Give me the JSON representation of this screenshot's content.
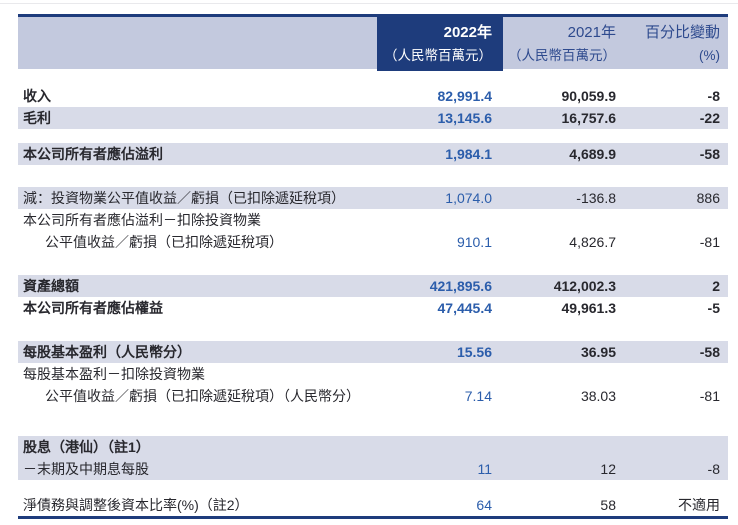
{
  "colors": {
    "navy": "#1e3c7c",
    "header_band": "#c3c9de",
    "row_stripe": "#d8dbe8",
    "value_2022_blue": "#2b5dab",
    "text_dark": "#28282e",
    "header_text_navy": "#2e4a8e"
  },
  "table": {
    "header": {
      "col2022": {
        "year": "2022年",
        "unit": "（人民幣百萬元）"
      },
      "col2021": {
        "year": "2021年",
        "unit": "（人民幣百萬元）"
      },
      "colpct": {
        "title": "百分比變動",
        "unit": "(%)"
      }
    },
    "rows": [
      {
        "label": "收入",
        "bold": true,
        "stripe": false,
        "v2022": "82,991.4",
        "v2021": "90,059.9",
        "pct": "-8"
      },
      {
        "label": "毛利",
        "bold": true,
        "stripe": true,
        "v2022": "13,145.6",
        "v2021": "16,757.6",
        "pct": "-22"
      },
      {
        "type": "spacer",
        "size": "s"
      },
      {
        "label": "本公司所有者應佔溢利",
        "bold": true,
        "stripe": true,
        "v2022": "1,984.1",
        "v2021": "4,689.9",
        "pct": "-58"
      },
      {
        "type": "spacer",
        "size": "m"
      },
      {
        "label": "減：投資物業公平值收益／虧損（已扣除遞延稅項）",
        "bold": false,
        "stripe": true,
        "v2022": "1,074.0",
        "v2021": "-136.8",
        "pct": "886"
      },
      {
        "label": "本公司所有者應佔溢利－扣除投資物業",
        "bold": false,
        "stripe": false,
        "v2022": "",
        "v2021": "",
        "pct": ""
      },
      {
        "label": "公平值收益／虧損（已扣除遞延稅項）",
        "indent": true,
        "bold": false,
        "stripe": false,
        "v2022": "910.1",
        "v2021": "4,826.7",
        "pct": "-81"
      },
      {
        "type": "spacer",
        "size": "m"
      },
      {
        "label": "資產總額",
        "bold": true,
        "stripe": true,
        "v2022": "421,895.6",
        "v2021": "412,002.3",
        "pct": "2"
      },
      {
        "label": "本公司所有者應佔權益",
        "bold": true,
        "stripe": false,
        "v2022": "47,445.4",
        "v2021": "49,961.3",
        "pct": "-5"
      },
      {
        "type": "spacer",
        "size": "m"
      },
      {
        "label": "每股基本盈利（人民幣分）",
        "bold": true,
        "stripe": true,
        "v2022": "15.56",
        "v2021": "36.95",
        "pct": "-58"
      },
      {
        "label": "每股基本盈利－扣除投資物業",
        "bold": false,
        "stripe": false,
        "v2022": "",
        "v2021": "",
        "pct": ""
      },
      {
        "label": "公平值收益／虧損（已扣除遞延稅項）（人民幣分）",
        "indent": true,
        "bold": false,
        "stripe": false,
        "v2022": "7.14",
        "v2021": "38.03",
        "pct": "-81"
      },
      {
        "type": "spacer",
        "size": "l"
      },
      {
        "label": "股息（港仙）（註1）",
        "bold": true,
        "stripe": true,
        "v2022": "",
        "v2021": "",
        "pct": ""
      },
      {
        "label": "－末期及中期息每股",
        "bold": false,
        "stripe": true,
        "v2022": "11",
        "v2021": "12",
        "pct": "-8"
      },
      {
        "type": "spacer",
        "size": "xs"
      },
      {
        "label": "淨債務與調整後資本比率(%)（註2）",
        "bold": false,
        "stripe": false,
        "last": true,
        "v2022": "64",
        "v2021": "58",
        "pct": "不適用"
      }
    ]
  }
}
